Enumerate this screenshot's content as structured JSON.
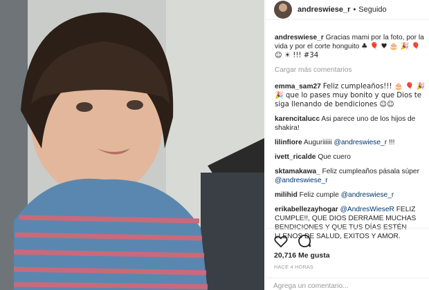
{
  "header": {
    "username": "andreswiese_r",
    "separator": "•",
    "follow_status": "Seguido"
  },
  "caption": {
    "username": "andreswiese_r",
    "text": "Gracias mami por la foto, por la vida y por el corte honguito",
    "emoji": "♣ 🎈 ♥ 🎂 🎉 🎈 ☺ ☀ !!! #34"
  },
  "load_more": "Cargar más comentarios",
  "comments": [
    {
      "user": "emma_sam27",
      "text": "Feliz cumpleaños!!! 🎂 🎈 🎉🎉 que lo pases muy bonito y que Dios te siga llenando de bendiciones ☺☺"
    },
    {
      "user": "karencitalucc",
      "text": "Asi parece uno de los hijos de shakira!"
    },
    {
      "user": "lilinfiore",
      "text": "Auguriiiiii ",
      "mention": "@andreswiese_r",
      "after": " !!!"
    },
    {
      "user": "ivett_ricalde",
      "text": "Que cuero"
    },
    {
      "user": "sktamakawa_",
      "text": "Feliz cumpleaños pásala súper ",
      "mention": "@andreswiese_r"
    },
    {
      "user": "milihid",
      "text": "Feliz cumple ",
      "mention": "@andreswiese_r"
    },
    {
      "user": "erikabellezayhogar",
      "text": "",
      "mention": "@AndresWieseR",
      "after": " FELIZ CUMPLE!!, QUE DIOS DERRAME MUCHAS BENDICIONES Y QUE TUS DÍAS ESTÉN LLENOS DE SALUD, EXITOS Y AMOR."
    }
  ],
  "actions": {
    "like_icon": "heart-icon",
    "comment_icon": "comment-icon"
  },
  "likes": "20,716 Me gusta",
  "timestamp": "HACE 4 HORAS",
  "add_comment_placeholder": "Agrega un comentario..."
}
